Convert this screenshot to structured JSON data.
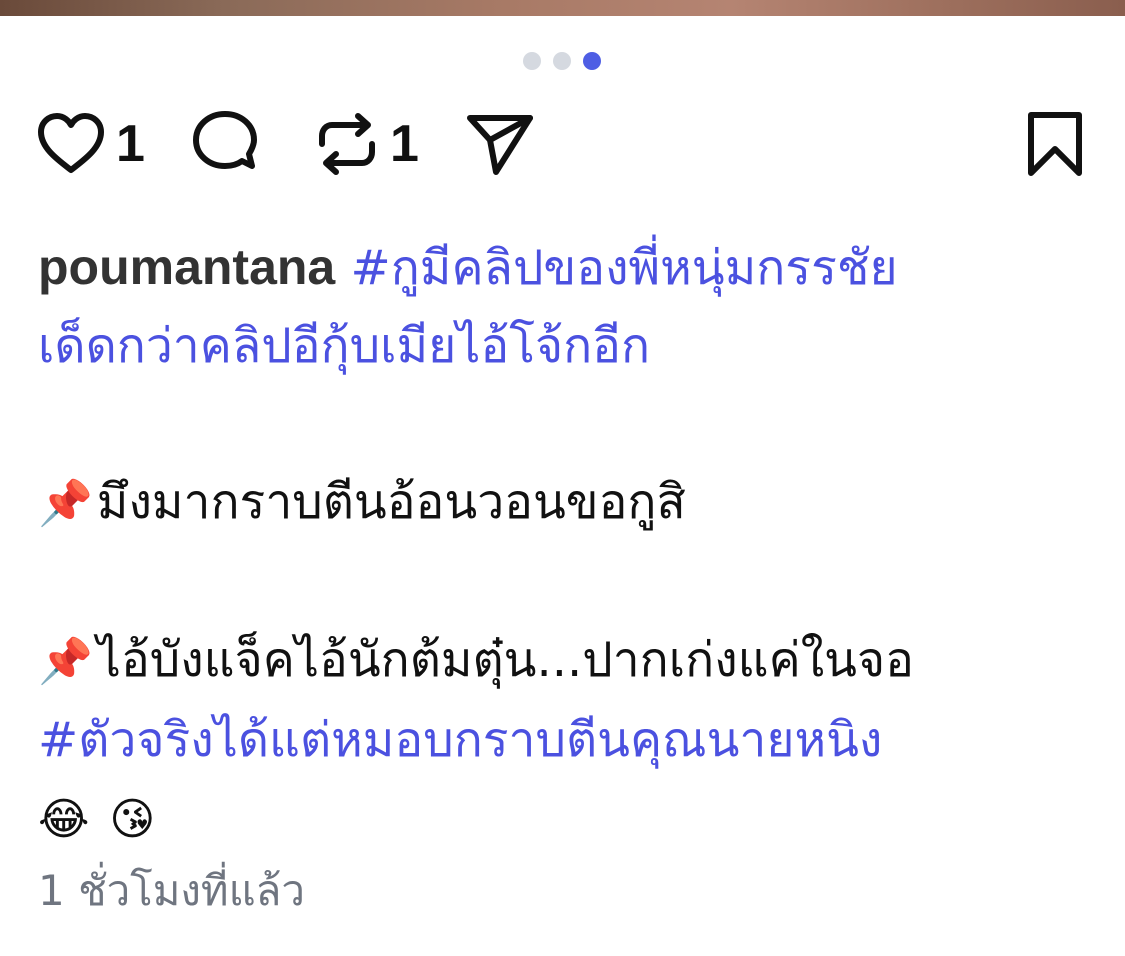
{
  "post": {
    "pager": {
      "count": 3,
      "active_index": 2
    },
    "actions": {
      "like_count": "1",
      "repost_count": "1"
    },
    "caption": {
      "username": "poumantana",
      "hashtag_1": "#กูมีคลิปของพี่หนุ่มกรรชัย",
      "line_2": "เด็ดกว่าคลิปอีกุ้บเมียไอ้โจ้กอีก",
      "pin_emoji": "📌",
      "line_3": "มึงมากราบตีนอ้อนวอนขอกูสิ",
      "line_4": "ไอ้บังแจ็คไอ้นักต้มตุ๋น...ปากเก่งแค่ในจอ",
      "hashtag_2": "#ตัวจริงได้แต่หมอบกราบตีนคุณนายหนิง",
      "emoji_1": "😂",
      "emoji_2": "😘"
    },
    "timestamp": "1 ชั่วโมงที่แล้ว"
  },
  "icons": {
    "like": "heart-icon",
    "comment": "comment-bubble-icon",
    "repost": "repost-icon",
    "share": "send-icon",
    "bookmark": "bookmark-icon"
  },
  "colors": {
    "hashtag": "#4b51e0",
    "pager_active": "#4e5ee4",
    "pager_inactive": "#d5d9e0",
    "timestamp": "#6f7580"
  }
}
